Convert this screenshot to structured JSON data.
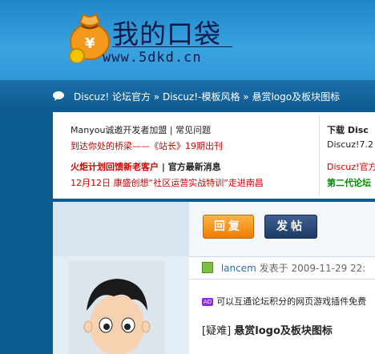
{
  "header": {
    "site_title": "我的口袋",
    "site_url": "www.5dkd.cn",
    "logo_icon": "money-bag-icon"
  },
  "breadcrumb": {
    "icon": "chat-bubble-icon",
    "items": [
      "Discuz! 论坛官方",
      "»",
      "Discuz!-模板风格",
      "»",
      "悬赏logo及板块图标"
    ]
  },
  "announcements": {
    "left": [
      {
        "a": "Manyou诚邀开发者加盟",
        "sep": " | ",
        "b": "常见问题"
      },
      {
        "a": "到达你处的桥梁——《站长》19期出刊"
      },
      {
        "a": "火炬计划回馈新老客户",
        "sep": " | ",
        "b": "官方最新消息"
      },
      {
        "a": "12月12日 康盛创想“社区运营实战特训”走进南昌"
      }
    ],
    "right": [
      {
        "a": "下载",
        "b": "Disc"
      },
      {
        "a": "Discuz!7.2"
      },
      {
        "a": "Discuz!官方"
      },
      {
        "a": "第二代论坛"
      }
    ]
  },
  "buttons": {
    "reply": "回复",
    "new_post": "发帖"
  },
  "post": {
    "author": "lancem",
    "posted_label": "发表于",
    "date": "2009-11-29 22:",
    "ad_badge": "AD",
    "ad_text": "可以互通论坛积分的网页游戏插件免费",
    "thread_prefix": "[疑难]",
    "thread_title": "悬赏logo及板块图标"
  },
  "colors": {
    "header_blue": "#2f97d6",
    "nav_blue": "#0f5a92",
    "reply_orange": "#f07c00",
    "post_navy": "#1e3b66",
    "link_red": "#d10000",
    "link_green": "#008a00"
  }
}
